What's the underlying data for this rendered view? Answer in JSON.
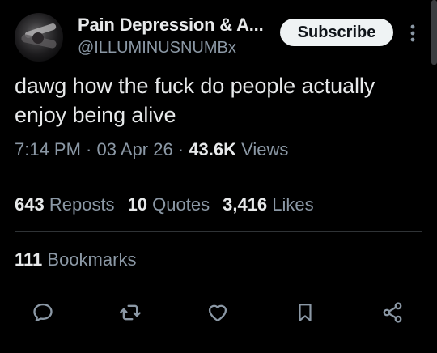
{
  "user": {
    "name": "Pain Depression & A...",
    "handle": "@ILLUMINUSNUMBx"
  },
  "subscribe_label": "Subscribe",
  "tweet": {
    "line1": "dawg how the fuck do people actually",
    "line2": "enjoy being alive"
  },
  "meta": {
    "time": "7:14 PM",
    "sep1": " · ",
    "date": "03 Apr 26",
    "sep2": " · ",
    "views_count": "43.6K",
    "views_label": " Views"
  },
  "stats": {
    "reposts_count": "643",
    "reposts_label": "Reposts",
    "quotes_count": "10",
    "quotes_label": "Quotes",
    "likes_count": "3,416",
    "likes_label": "Likes",
    "bookmarks_count": "111",
    "bookmarks_label": "Bookmarks"
  },
  "actions": [
    "reply-icon",
    "repost-icon",
    "like-icon",
    "bookmark-icon",
    "share-icon"
  ],
  "colors": {
    "background": "#000000",
    "text": "#e7e9ea",
    "secondary": "#8b98a5",
    "divider": "#2f3336",
    "button_bg": "#eff3f4",
    "button_text": "#0f1419"
  }
}
